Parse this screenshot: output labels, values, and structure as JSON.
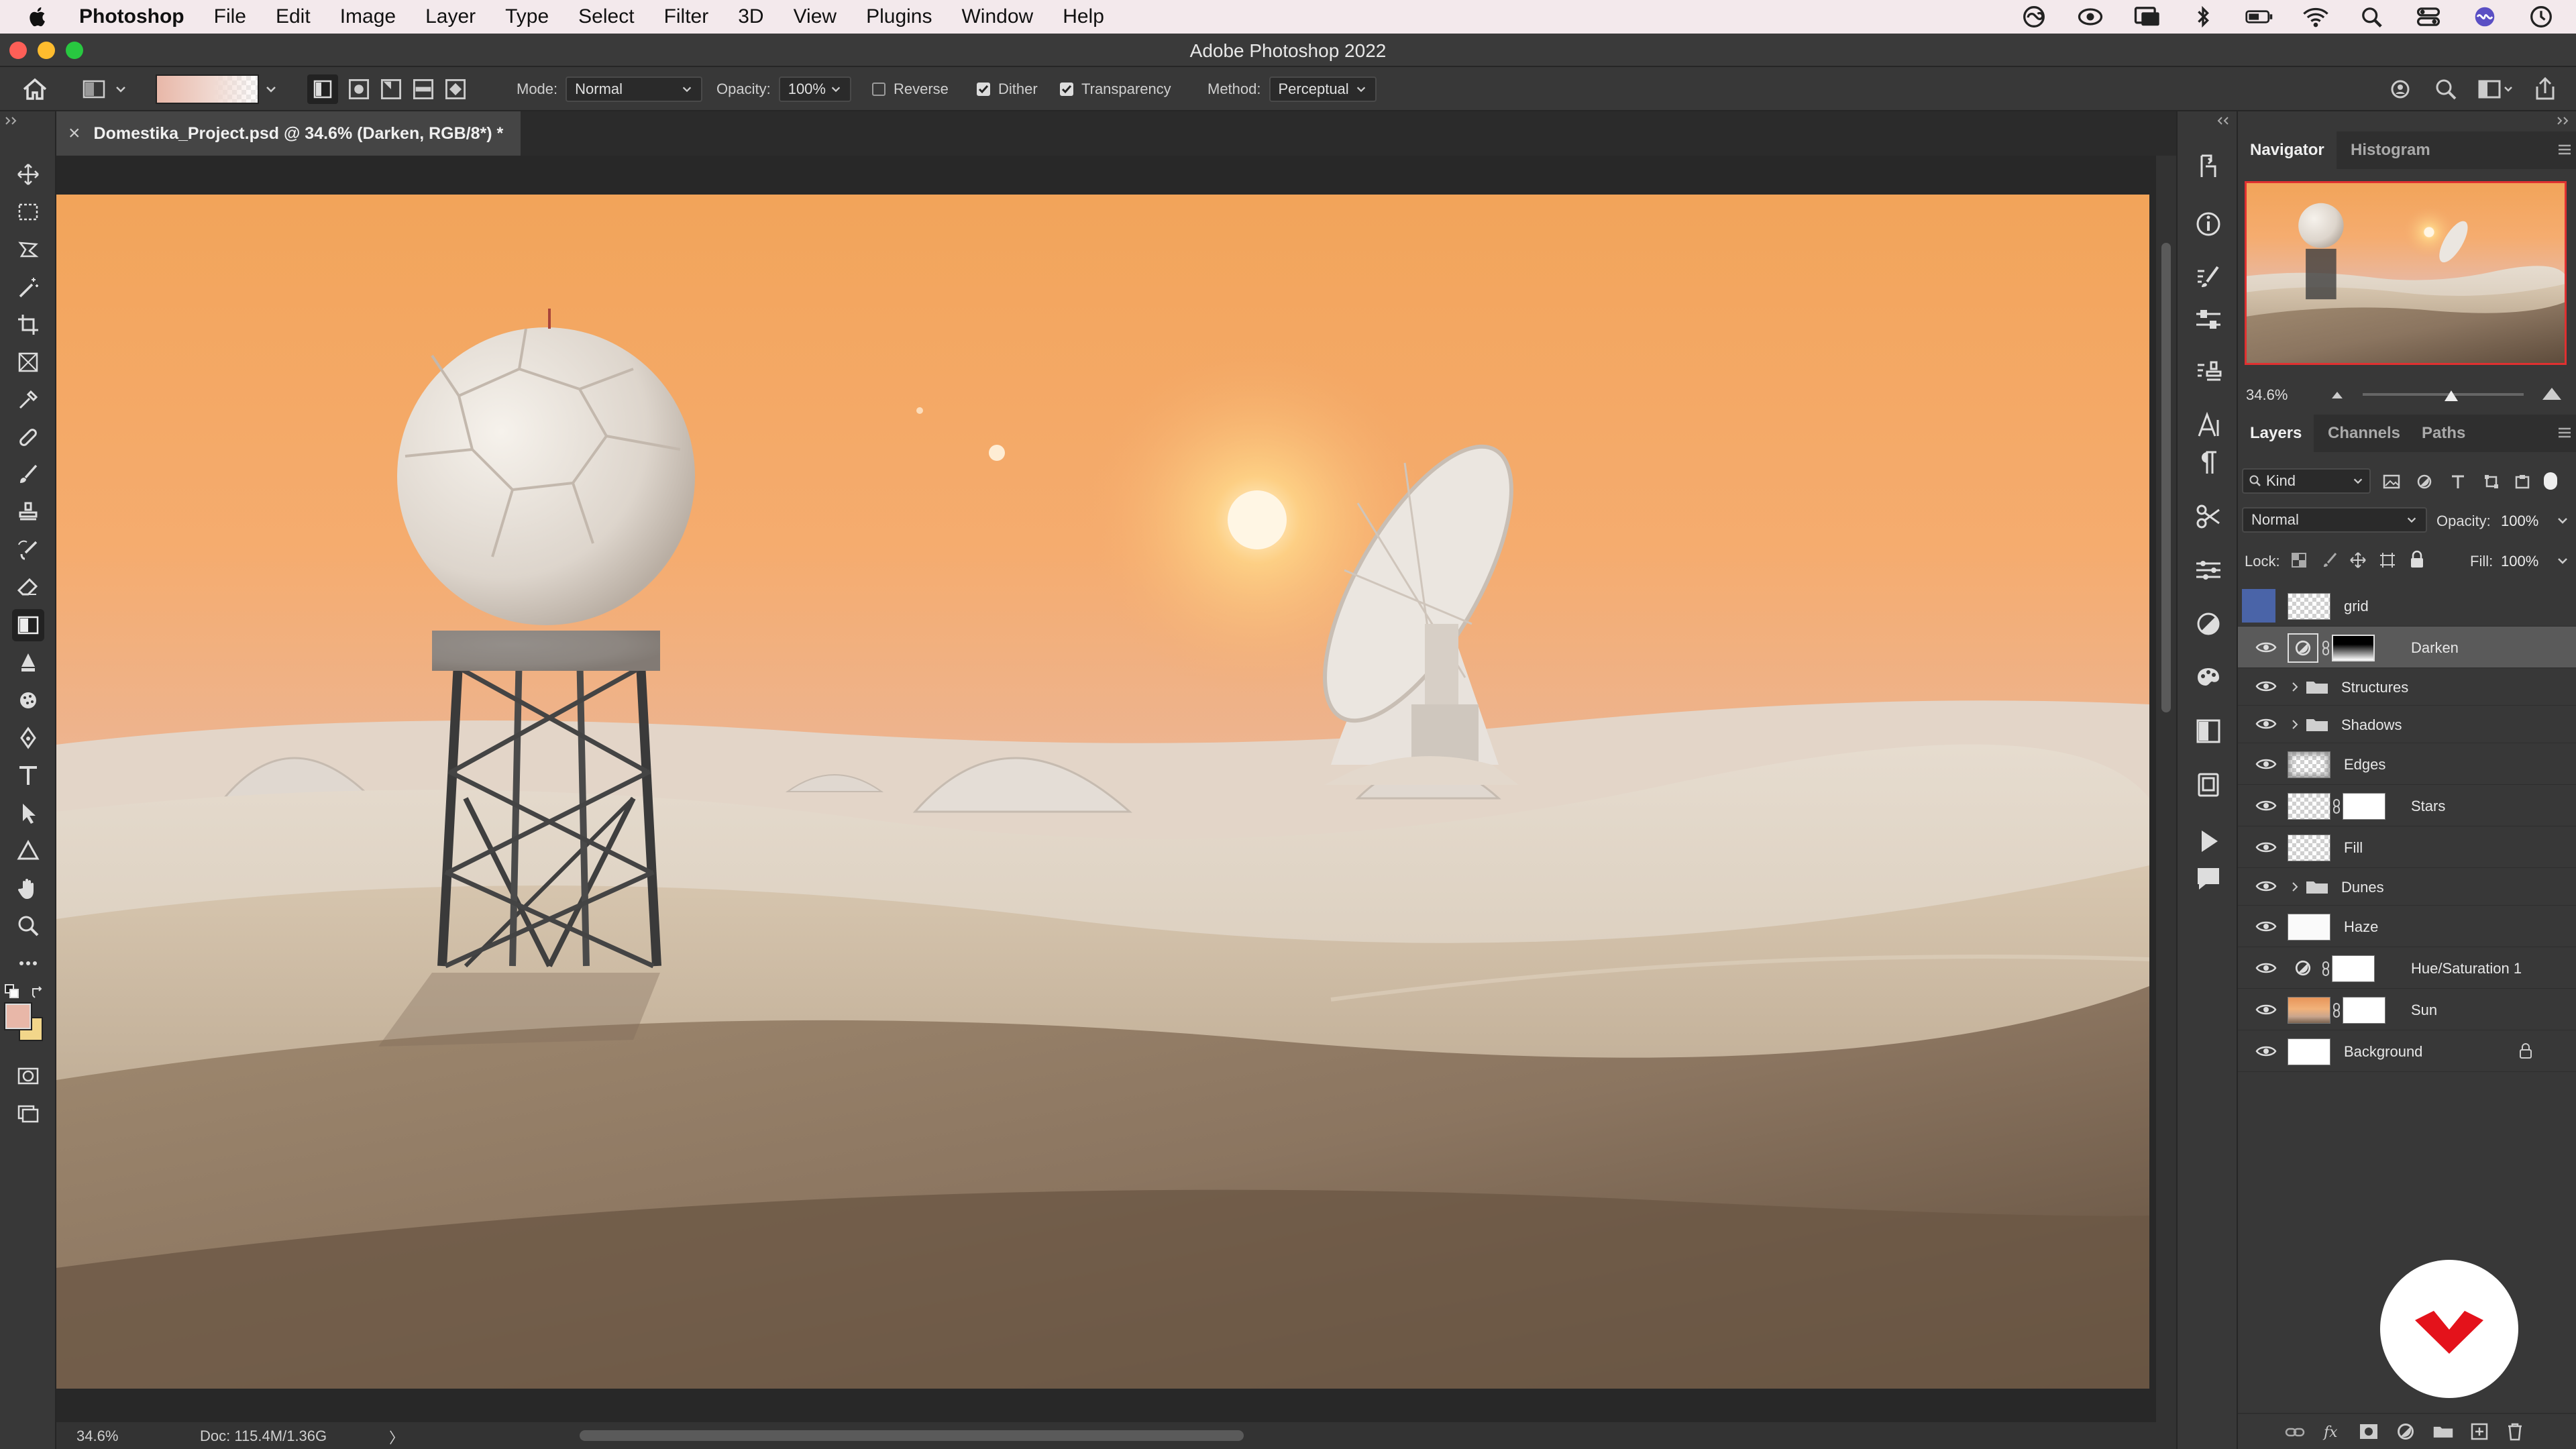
{
  "menubar": {
    "app_name": "Photoshop",
    "items": [
      "File",
      "Edit",
      "Image",
      "Layer",
      "Type",
      "Select",
      "Filter",
      "3D",
      "View",
      "Plugins",
      "Window",
      "Help"
    ]
  },
  "window": {
    "title": "Adobe Photoshop 2022"
  },
  "options_bar": {
    "mode_label": "Mode:",
    "mode_value": "Normal",
    "opacity_label": "Opacity:",
    "opacity_value": "100%",
    "reverse_label": "Reverse",
    "dither_label": "Dither",
    "transparency_label": "Transparency",
    "method_label": "Method:",
    "method_value": "Perceptual",
    "checkboxes": {
      "reverse": false,
      "dither": true,
      "transparency": true
    }
  },
  "document": {
    "tab_title": "Domestika_Project.psd @ 34.6% (Darken, RGB/8*) *",
    "close_glyph": "×"
  },
  "status": {
    "zoom": "34.6%",
    "doc": "Doc: 115.4M/1.36G",
    "arrow": "〉"
  },
  "navigator": {
    "tabs": [
      "Navigator",
      "Histogram"
    ],
    "zoom": "34.6%",
    "zoom_level": 0.55
  },
  "layers_panel": {
    "tabs": [
      "Layers",
      "Channels",
      "Paths"
    ],
    "filter_kind": "Kind",
    "blend_mode": "Normal",
    "opacity_label": "Opacity:",
    "opacity_value": "100%",
    "lock_label": "Lock:",
    "fill_label": "Fill:",
    "fill_value": "100%",
    "layers": [
      {
        "name": "grid",
        "visible": false,
        "type": "pixel"
      },
      {
        "name": "Darken",
        "visible": true,
        "type": "adjustment",
        "selected": true
      },
      {
        "name": "Structures",
        "visible": true,
        "type": "group"
      },
      {
        "name": "Shadows",
        "visible": true,
        "type": "group"
      },
      {
        "name": "Edges",
        "visible": true,
        "type": "pixel"
      },
      {
        "name": "Stars",
        "visible": true,
        "type": "masked"
      },
      {
        "name": "Fill",
        "visible": true,
        "type": "pixel"
      },
      {
        "name": "Dunes",
        "visible": true,
        "type": "group"
      },
      {
        "name": "Haze",
        "visible": true,
        "type": "pixel"
      },
      {
        "name": "Hue/Saturation 1",
        "visible": true,
        "type": "adjustment"
      },
      {
        "name": "Sun",
        "visible": true,
        "type": "masked"
      },
      {
        "name": "Background",
        "visible": true,
        "type": "locked"
      }
    ]
  },
  "colors": {
    "foreground": "#e8b7a8",
    "background": "#f2d68a",
    "logo_red": "#e4121b"
  }
}
